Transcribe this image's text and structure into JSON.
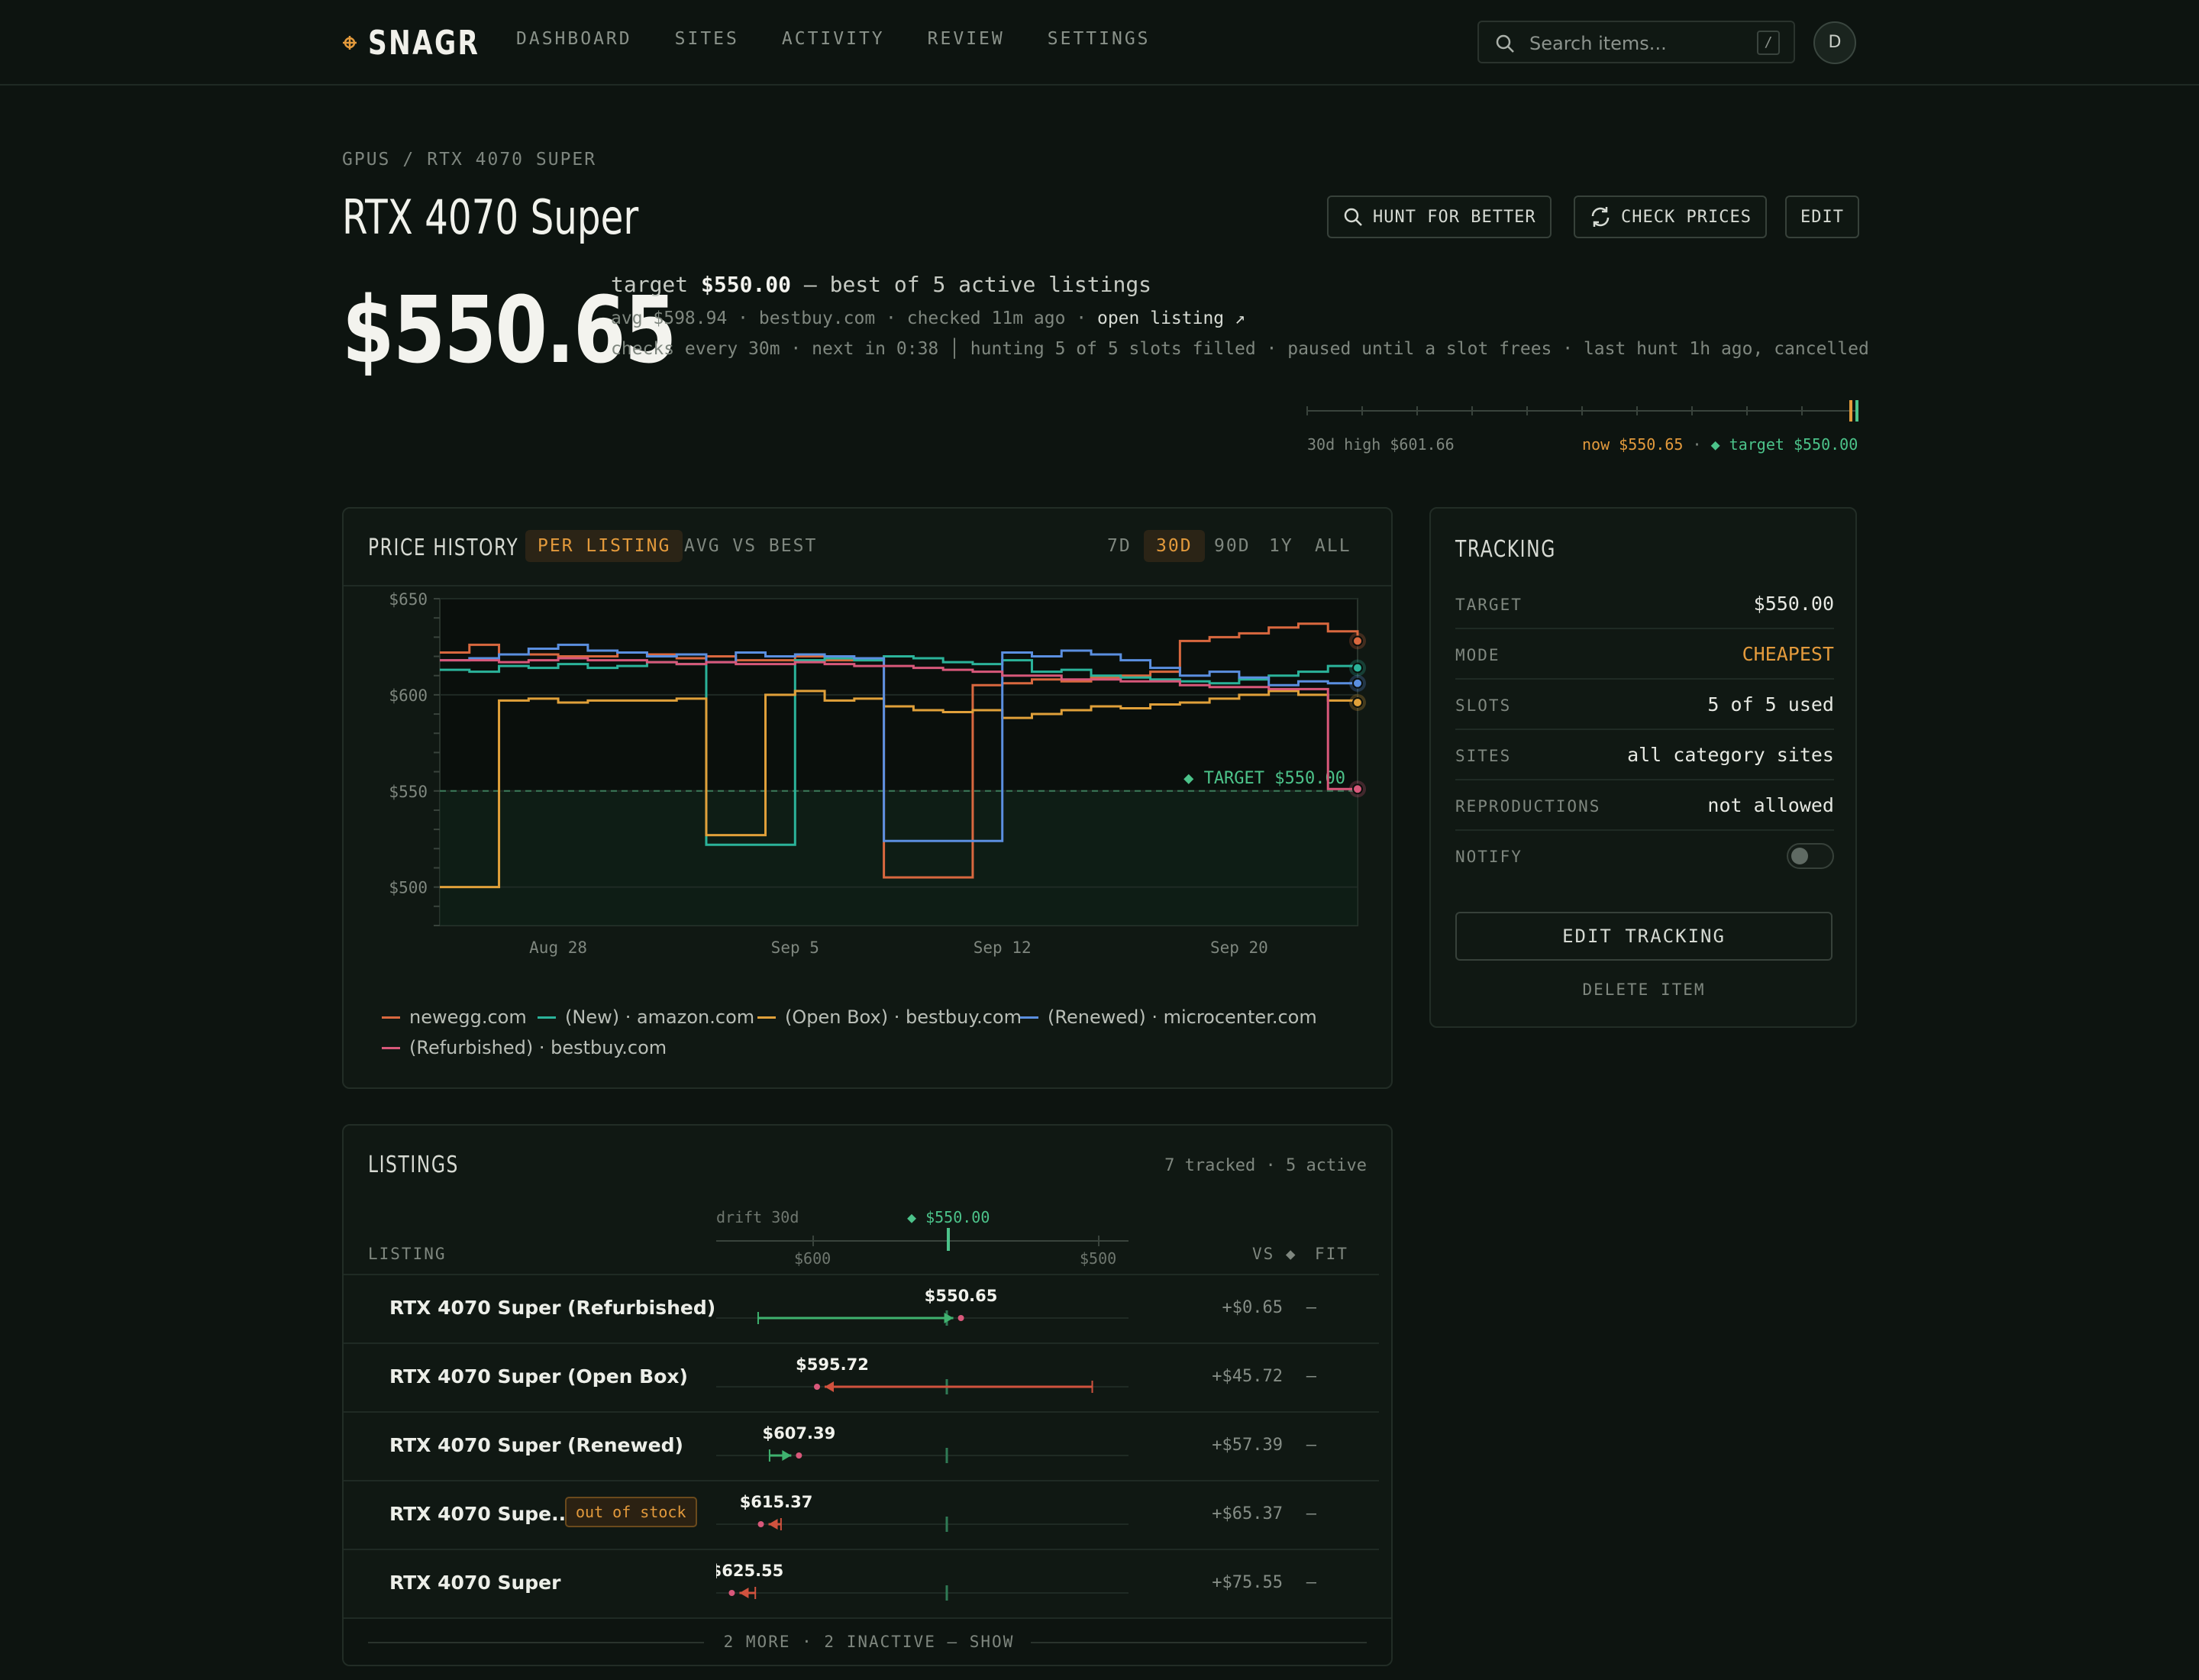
{
  "app": {
    "name": "SNAGR",
    "logo_icon": "crosshair-icon",
    "accent": "#e39a3c"
  },
  "nav": [
    "DASHBOARD",
    "SITES",
    "ACTIVITY",
    "REVIEW",
    "SETTINGS"
  ],
  "search": {
    "placeholder": "Search items...",
    "shortcut": "/"
  },
  "user": {
    "initial": "D"
  },
  "breadcrumb": [
    "GPUS",
    "/",
    "RTX 4070 SUPER"
  ],
  "item": {
    "title": "RTX 4070 Super",
    "price": "$550.65"
  },
  "actions": {
    "hunt": "HUNT FOR BETTER",
    "check": "CHECK PRICES",
    "edit": "EDIT"
  },
  "summary": {
    "target_prefix": "target",
    "target_value": "$550.00",
    "target_suffix": "— best of 5 active listings",
    "line2": "avg $598.94 · bestbuy.com · checked 11m ago ·",
    "open_listing": "open listing ↗",
    "line3": "checks every 30m · next in 0:38 │ hunting 5 of 5 slots filled · paused until a slot frees · last hunt 1h ago, cancelled"
  },
  "range": {
    "high": "30d high $601.66",
    "now": "now $550.65",
    "sep": "·",
    "target": "◆ target $550.00",
    "now_color": "#e39a3c",
    "target_color": "#4cc38a"
  },
  "history": {
    "title": "PRICE HISTORY",
    "modes": [
      "PER LISTING",
      "AVG VS BEST"
    ],
    "active_mode": "PER LISTING",
    "ranges": [
      "7D",
      "30D",
      "90D",
      "1Y",
      "ALL"
    ],
    "active_range": "30D",
    "target_label": "◆ TARGET $550.00",
    "legend": [
      {
        "name": "newegg.com",
        "color": "#d9683f"
      },
      {
        "name": "(New) · amazon.com",
        "color": "#2bb39a"
      },
      {
        "name": "(Open Box) · bestbuy.com",
        "color": "#e0a03a"
      },
      {
        "name": "(Renewed) · microcenter.com",
        "color": "#5b8fe0"
      },
      {
        "name": "(Refurbished) · bestbuy.com",
        "color": "#d8587a"
      }
    ]
  },
  "chart_data": {
    "type": "line",
    "ylim": [
      480,
      650
    ],
    "yticks": [
      "$650",
      "$600",
      "$550",
      "$500"
    ],
    "ytick_values": [
      650,
      600,
      550,
      500
    ],
    "xticks": [
      "Aug 28",
      "Sep 5",
      "Sep 12",
      "Sep 20"
    ],
    "xtick_days": [
      28,
      36,
      43,
      51
    ],
    "xlim": [
      24,
      55
    ],
    "target": 550,
    "series": [
      {
        "name": "newegg.com",
        "color": "#d9683f",
        "x": [
          24,
          25,
          26,
          28,
          30,
          31,
          32,
          33,
          34,
          35,
          36,
          37,
          38,
          39,
          40,
          41,
          42,
          43,
          44,
          45,
          46,
          47,
          48,
          49,
          50,
          51,
          52,
          53,
          54,
          55
        ],
        "values": [
          622,
          626,
          621,
          620,
          622,
          621,
          619,
          620,
          618,
          618,
          620,
          618,
          618,
          505,
          505,
          505,
          605,
          606,
          608,
          607,
          609,
          610,
          612,
          628,
          630,
          632,
          635,
          637,
          633,
          628
        ]
      },
      {
        "name": "(New) · amazon.com",
        "color": "#2bb39a",
        "x": [
          24,
          25,
          26,
          27,
          28,
          29,
          30,
          31,
          32,
          33,
          34,
          35,
          36,
          37,
          38,
          39,
          40,
          41,
          42,
          43,
          44,
          45,
          46,
          47,
          48,
          49,
          50,
          51,
          52,
          53,
          54,
          55
        ],
        "values": [
          613,
          612,
          615,
          614,
          616,
          614,
          615,
          617,
          616,
          522,
          522,
          522,
          618,
          619,
          618,
          620,
          619,
          617,
          616,
          618,
          612,
          613,
          610,
          609,
          608,
          607,
          606,
          608,
          610,
          612,
          615,
          614
        ]
      },
      {
        "name": "(Open Box) · bestbuy.com",
        "color": "#e0a03a",
        "x": [
          24,
          25,
          26,
          27,
          28,
          29,
          30,
          31,
          32,
          33,
          34,
          35,
          36,
          37,
          38,
          39,
          40,
          41,
          42,
          43,
          44,
          45,
          46,
          47,
          48,
          49,
          50,
          51,
          52,
          53,
          54,
          55
        ],
        "values": [
          500,
          500,
          597,
          598,
          596,
          597,
          597,
          597,
          598,
          527,
          527,
          600,
          602,
          597,
          598,
          594,
          592,
          591,
          592,
          588,
          590,
          592,
          594,
          593,
          595,
          596,
          598,
          600,
          602,
          600,
          597,
          596
        ]
      },
      {
        "name": "(Renewed) · microcenter.com",
        "color": "#5b8fe0",
        "x": [
          24,
          25,
          26,
          27,
          28,
          29,
          30,
          31,
          32,
          33,
          34,
          35,
          36,
          37,
          38,
          39,
          40,
          41,
          42,
          43,
          44,
          45,
          46,
          47,
          48,
          49,
          50,
          51,
          52,
          53,
          54,
          55
        ],
        "values": [
          618,
          619,
          621,
          624,
          626,
          623,
          622,
          620,
          621,
          617,
          622,
          620,
          621,
          620,
          619,
          524,
          524,
          524,
          524,
          622,
          620,
          623,
          621,
          618,
          614,
          610,
          612,
          609,
          605,
          607,
          606,
          606
        ]
      },
      {
        "name": "(Refurbished) · bestbuy.com",
        "color": "#d8587a",
        "x": [
          24,
          25,
          26,
          27,
          28,
          29,
          30,
          31,
          32,
          33,
          34,
          35,
          36,
          37,
          38,
          39,
          40,
          41,
          42,
          43,
          44,
          45,
          46,
          47,
          48,
          49,
          50,
          51,
          52,
          53,
          54,
          55
        ],
        "values": [
          618,
          618,
          617,
          618,
          619,
          618,
          618,
          617,
          616,
          617,
          616,
          616,
          617,
          616,
          615,
          615,
          614,
          613,
          612,
          610,
          610,
          608,
          608,
          607,
          607,
          605,
          604,
          604,
          603,
          603,
          551,
          551
        ]
      }
    ]
  },
  "tracking": {
    "title": "TRACKING",
    "rows": [
      {
        "label": "TARGET",
        "value": "$550.00"
      },
      {
        "label": "MODE",
        "value": "CHEAPEST"
      },
      {
        "label": "SLOTS",
        "value": "5 of 5 used"
      },
      {
        "label": "SITES",
        "value": "all category sites"
      },
      {
        "label": "REPRODUCTIONS",
        "value": "not allowed"
      },
      {
        "label": "NOTIFY",
        "value": ""
      }
    ],
    "notify_on": false,
    "edit": "EDIT TRACKING",
    "delete": "DELETE ITEM"
  },
  "listings": {
    "title": "LISTINGS",
    "meta": "7 tracked · 5 active",
    "drift_label": "drift 30d",
    "drift_target": "◆ $550.00",
    "scale": [
      "$600",
      "$500"
    ],
    "col_listing": "LISTING",
    "col_vs": "VS ◆",
    "col_fit": "FIT",
    "rows": [
      {
        "name": "RTX 4070 Super (Refurbished)",
        "price": "$550.65",
        "vs": "+$0.65",
        "fit": "—",
        "badge": "",
        "start": 619,
        "end": 550.65,
        "color": "#3fb26f"
      },
      {
        "name": "RTX 4070 Super (Open Box)",
        "price": "$595.72",
        "vs": "+$45.72",
        "fit": "—",
        "badge": "",
        "start": 502,
        "end": 595.72,
        "color": "#d0523e"
      },
      {
        "name": "RTX 4070 Super (Renewed)",
        "price": "$607.39",
        "vs": "+$57.39",
        "fit": "—",
        "badge": "",
        "start": 615,
        "end": 607.39,
        "color": "#3fb26f"
      },
      {
        "name": "RTX 4070 Supe...",
        "price": "$615.37",
        "vs": "+$65.37",
        "fit": "—",
        "badge": "out of stock",
        "start": 611,
        "end": 615.37,
        "color": "#d0523e"
      },
      {
        "name": "RTX 4070 Super",
        "price": "$625.55",
        "vs": "+$75.55",
        "fit": "—",
        "badge": "",
        "start": 620,
        "end": 625.55,
        "color": "#d0523e"
      }
    ],
    "more": "2 MORE · 2 INACTIVE — SHOW"
  }
}
